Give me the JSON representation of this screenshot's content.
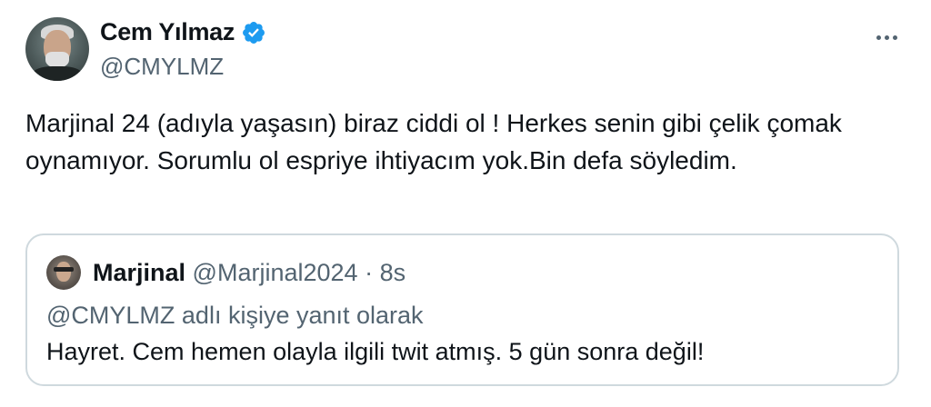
{
  "tweet": {
    "author_name": "Cem Yılmaz",
    "author_handle": "@CMYLMZ",
    "verified_icon": "verified-badge-icon",
    "more_icon": "more-options-icon",
    "text": "Marjinal 24 (adıyla yaşasın) biraz ciddi ol ! Herkes senin gibi çelik çomak oynamıyor. Sorumlu ol espriye ihtiyacım yok.Bin defa söyledim.",
    "accent_color": "#1d9bf0"
  },
  "quoted": {
    "author_name": "Marjinal",
    "author_handle": "@Marjinal2024",
    "separator": "·",
    "time": "8s",
    "reply_context": "@CMYLMZ adlı kişiye yanıt olarak",
    "text": "Hayret. Cem hemen olayla ilgili twit atmış. 5 gün sonra değil!"
  }
}
